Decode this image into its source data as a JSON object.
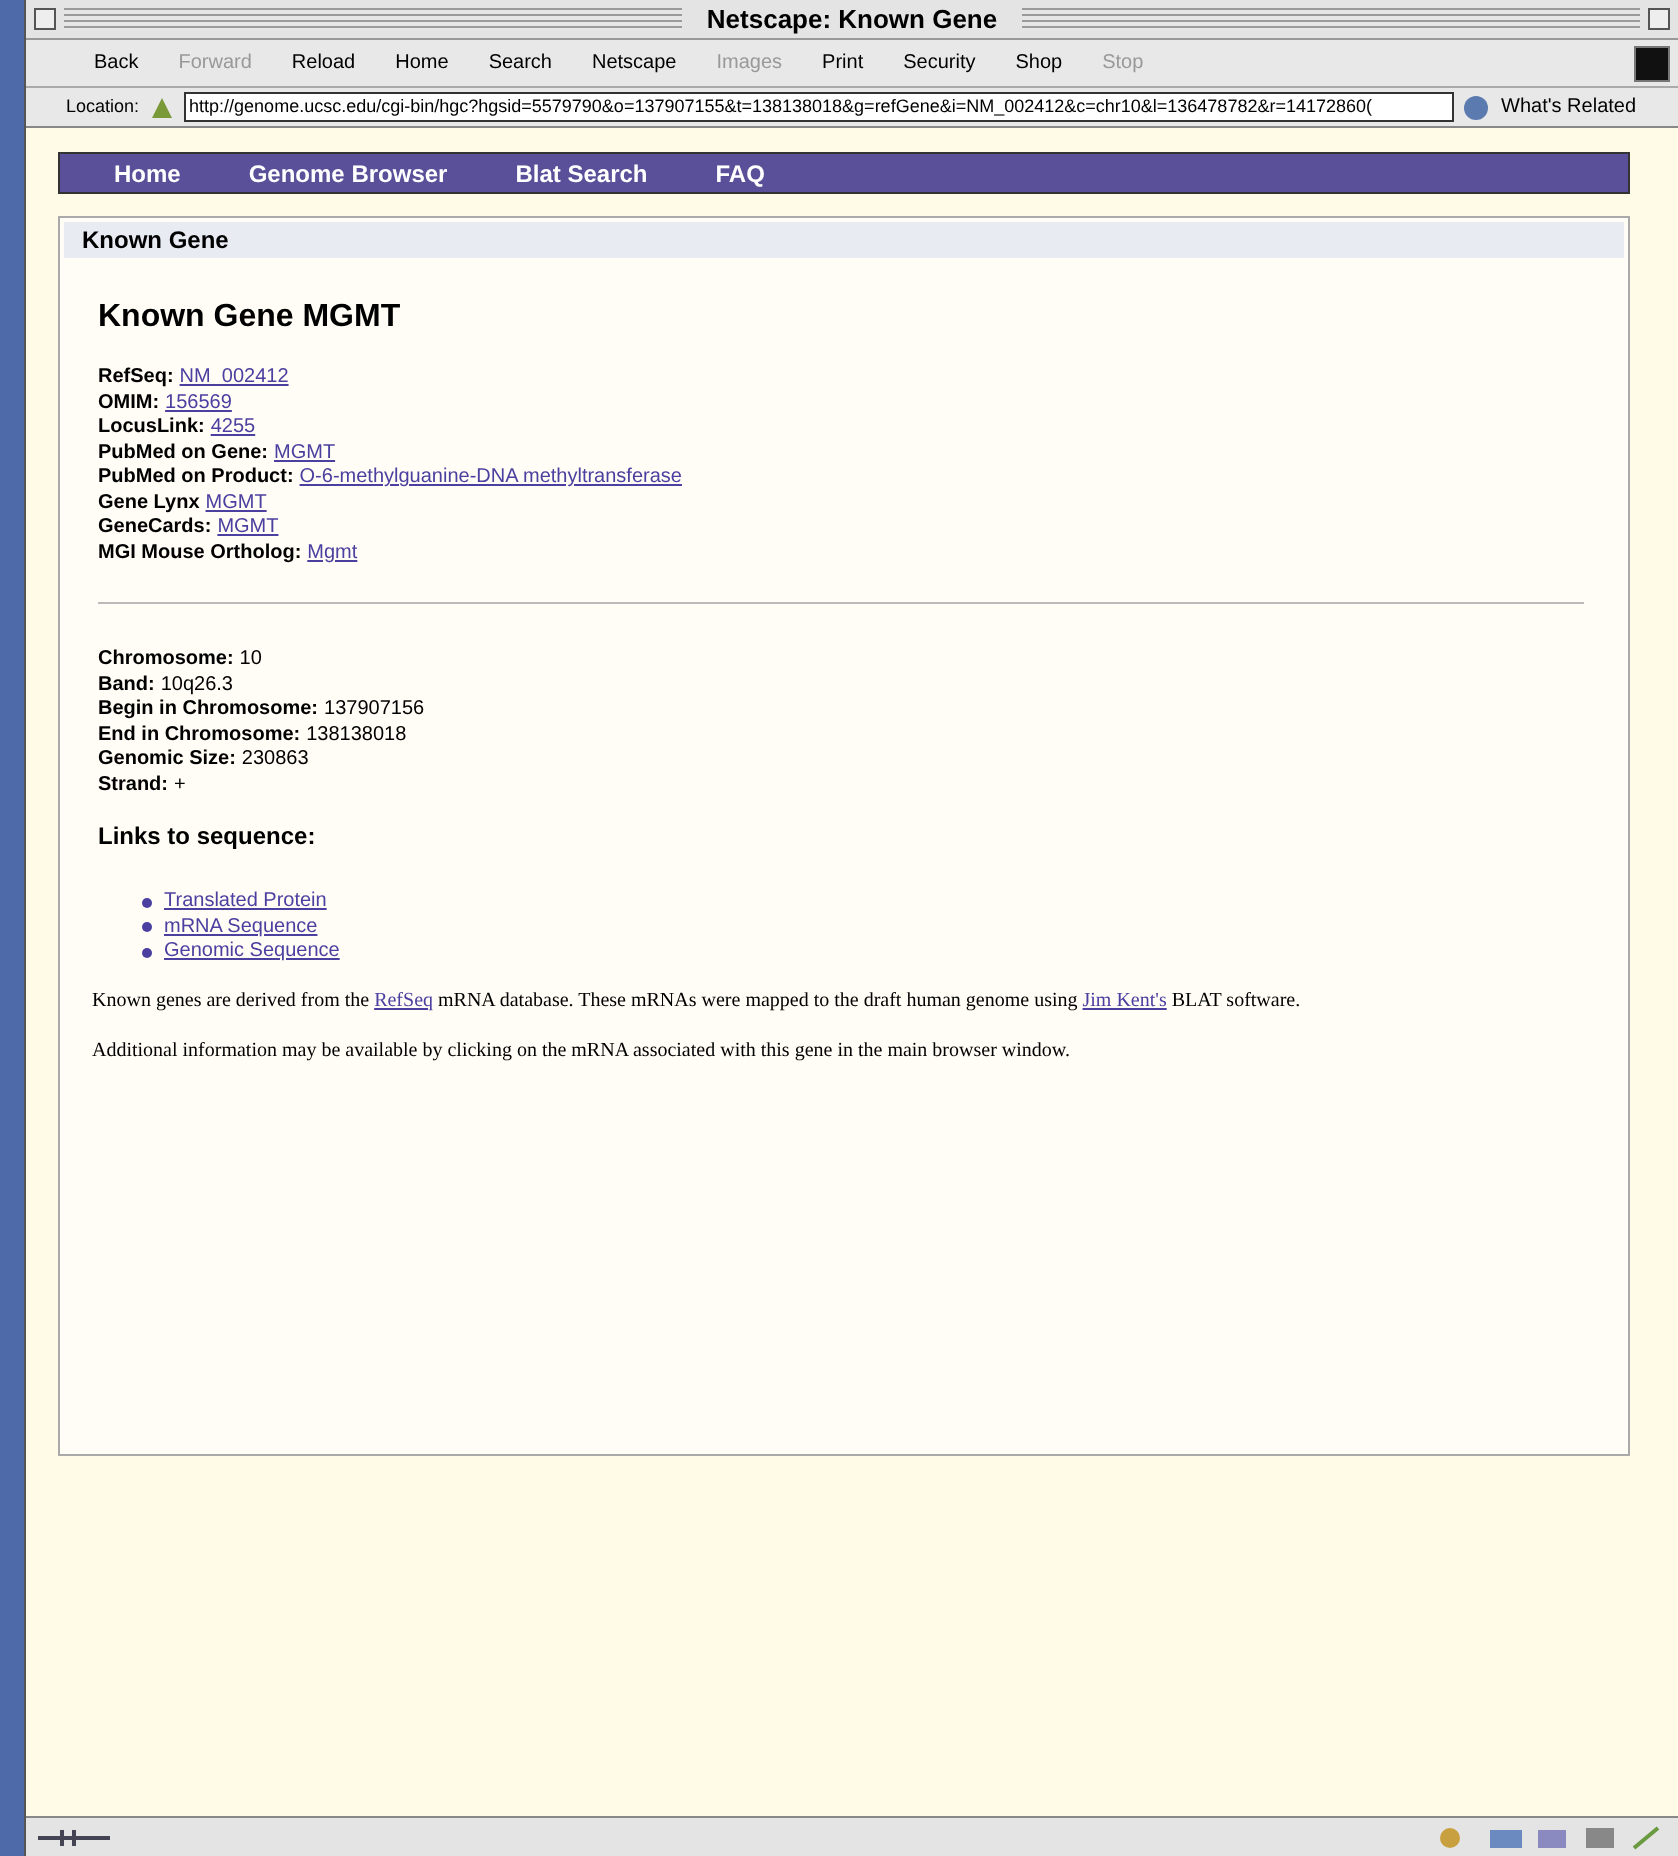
{
  "window": {
    "title": "Netscape: Known Gene"
  },
  "toolbar": [
    {
      "label": "Back",
      "disabled": false
    },
    {
      "label": "Forward",
      "disabled": true
    },
    {
      "label": "Reload",
      "disabled": false
    },
    {
      "label": "Home",
      "disabled": false
    },
    {
      "label": "Search",
      "disabled": false
    },
    {
      "label": "Netscape",
      "disabled": false
    },
    {
      "label": "Images",
      "disabled": true
    },
    {
      "label": "Print",
      "disabled": false
    },
    {
      "label": "Security",
      "disabled": false
    },
    {
      "label": "Shop",
      "disabled": false
    },
    {
      "label": "Stop",
      "disabled": true
    }
  ],
  "location": {
    "label": "Location:",
    "value": "http://genome.ucsc.edu/cgi-bin/hgc?hgsid=5579790&o=137907155&t=138138018&g=refGene&i=NM_002412&c=chr10&l=136478782&r=14172860(",
    "related": "What's Related"
  },
  "nav": [
    "Home",
    "Genome Browser",
    "Blat Search",
    "FAQ"
  ],
  "card": {
    "header": "Known Gene",
    "title": "Known Gene MGMT",
    "gene_links": [
      {
        "label": "RefSeq:",
        "value": "NM_002412"
      },
      {
        "label": "OMIM:",
        "value": "156569"
      },
      {
        "label": "LocusLink:",
        "value": "4255"
      },
      {
        "label": "PubMed on Gene:",
        "value": "MGMT"
      },
      {
        "label": "PubMed on Product:",
        "value": "O-6-methylguanine-DNA methyltransferase"
      },
      {
        "label": "Gene Lynx",
        "value": "MGMT"
      },
      {
        "label": "GeneCards:",
        "value": "MGMT"
      },
      {
        "label": "MGI Mouse Ortholog:",
        "value": "Mgmt"
      }
    ],
    "position": [
      {
        "label": "Chromosome:",
        "value": "10"
      },
      {
        "label": "Band:",
        "value": "10q26.3"
      },
      {
        "label": "Begin in Chromosome:",
        "value": "137907156"
      },
      {
        "label": "End in Chromosome:",
        "value": "138138018"
      },
      {
        "label": "Genomic Size:",
        "value": "230863"
      },
      {
        "label": "Strand:",
        "value": "+"
      }
    ],
    "links_heading": "Links to sequence:",
    "sequence_links": [
      "Translated Protein",
      "mRNA Sequence",
      "Genomic Sequence"
    ],
    "paragraphs": [
      [
        {
          "kind": "text",
          "text": "Known genes are derived from the "
        },
        {
          "kind": "link",
          "text": "RefSeq"
        },
        {
          "kind": "text",
          "text": " mRNA database. These mRNAs were mapped to the draft human genome using "
        },
        {
          "kind": "link",
          "text": "Jim Kent's"
        },
        {
          "kind": "text",
          "text": " BLAT software."
        }
      ],
      [
        {
          "kind": "text",
          "text": "Additional information may be available by clicking on the mRNA associated with this gene in the main browser window."
        }
      ]
    ]
  }
}
